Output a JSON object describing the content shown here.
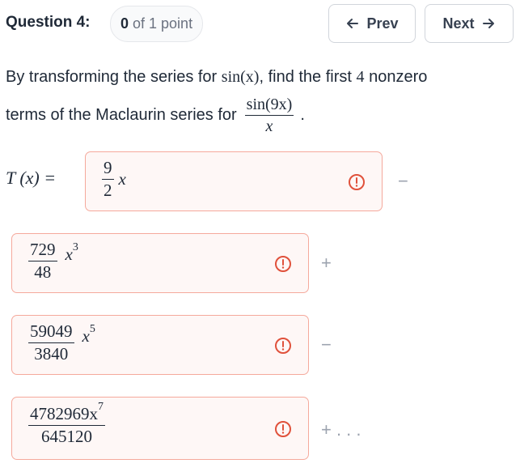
{
  "header": {
    "question_label": "Question 4:",
    "points_bold": "0",
    "points_rest": "of 1 point",
    "prev_label": "Prev",
    "next_label": "Next"
  },
  "prompt": {
    "text_a": "By transforming the series for ",
    "sin_x": "sin(x)",
    "text_b": ", find the first ",
    "count": "4",
    "text_c": " nonzero",
    "text_d": "terms of the Maclaurin series for",
    "frac_num": "sin(9x)",
    "frac_den": "x",
    "period": "."
  },
  "taylor": {
    "label": "T (x) =",
    "terms": [
      {
        "num": "9",
        "den": "2",
        "var": "x",
        "power": "",
        "sign_after": "−"
      },
      {
        "num": "729",
        "den": "48",
        "var": "x",
        "power": "3",
        "sign_after": "+"
      },
      {
        "num": "59049",
        "den": "3840",
        "var": "x",
        "power": "5",
        "sign_after": "−"
      },
      {
        "num": "4782969x",
        "num_power": "7",
        "den": "645120",
        "sign_after": "+ . . ."
      }
    ]
  },
  "colors": {
    "error_border": "#f5a99c",
    "error_bg": "#fef7f6",
    "error_icon": "#e0513b"
  },
  "icons": {
    "prev": "arrow-left-icon",
    "next": "arrow-right-icon",
    "warning": "exclamation-circle-icon"
  }
}
